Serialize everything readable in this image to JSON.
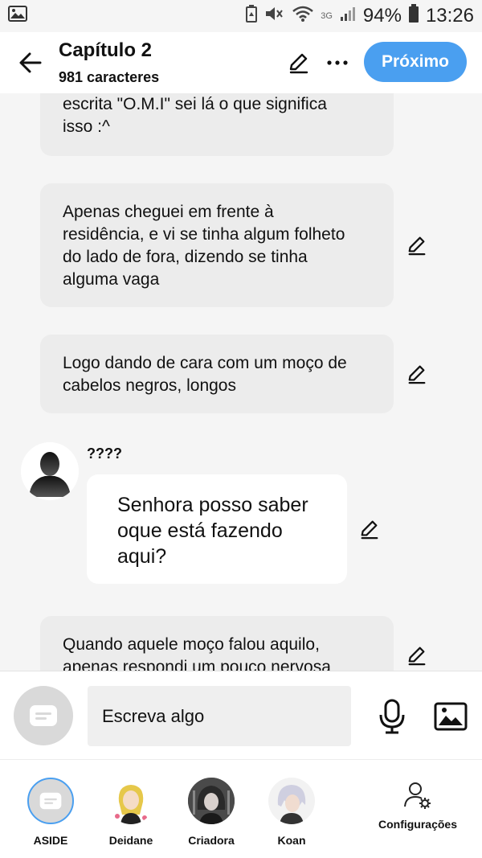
{
  "status_bar": {
    "battery": "94%",
    "time": "13:26",
    "network": "3G"
  },
  "header": {
    "title": "Capítulo 2",
    "subtitle": "981 caracteres",
    "next_label": "Próximo"
  },
  "messages": [
    {
      "text": "escrita \"O.M.I\" sei lá o que significa isso :^"
    },
    {
      "text": "Apenas cheguei em frente à residência, e vi se tinha algum folheto do lado de fora, dizendo se tinha alguma vaga"
    },
    {
      "text": "Logo dando de cara com um moço de cabelos negros, longos"
    },
    {
      "character": "????",
      "text": "Senhora posso saber oque está fazendo aqui?"
    },
    {
      "text": "Quando aquele moço falou aquilo, apenas respondi um pouco nervosa"
    }
  ],
  "composer": {
    "placeholder": "Escreva algo"
  },
  "bottom_bar": {
    "characters": [
      {
        "label": "ASIDE"
      },
      {
        "label": "Deidane"
      },
      {
        "label": "Criadora"
      },
      {
        "label": "Koan"
      }
    ],
    "settings_label": "Configurações"
  },
  "colors": {
    "accent": "#4a9ff0",
    "bubble": "#ececec",
    "background": "#f5f5f5"
  }
}
